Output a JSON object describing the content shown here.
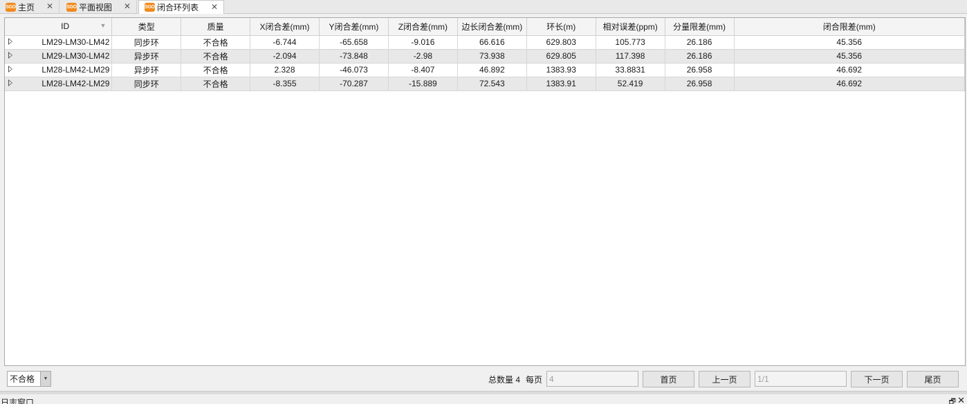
{
  "tabs": [
    {
      "label": "主页",
      "logo": "SGO",
      "close": "✕"
    },
    {
      "label": "平面视图",
      "logo": "SGO",
      "close": "✕"
    },
    {
      "label": "闭合环列表",
      "logo": "SGO",
      "close": "✕"
    }
  ],
  "table": {
    "columns": [
      "ID",
      "类型",
      "质量",
      "X闭合差(mm)",
      "Y闭合差(mm)",
      "Z闭合差(mm)",
      "边长闭合差(mm)",
      "环长(m)",
      "相对误差(ppm)",
      "分量限差(mm)",
      "闭合限差(mm)"
    ],
    "rows": [
      [
        "LM29-LM30-LM42",
        "同步环",
        "不合格",
        "-6.744",
        "-65.658",
        "-9.016",
        "66.616",
        "629.803",
        "105.773",
        "26.186",
        "45.356"
      ],
      [
        "LM29-LM30-LM42",
        "异步环",
        "不合格",
        "-2.094",
        "-73.848",
        "-2.98",
        "73.938",
        "629.805",
        "117.398",
        "26.186",
        "45.356"
      ],
      [
        "LM28-LM42-LM29",
        "异步环",
        "不合格",
        "2.328",
        "-46.073",
        "-8.407",
        "46.892",
        "1383.93",
        "33.8831",
        "26.958",
        "46.692"
      ],
      [
        "LM28-LM42-LM29",
        "同步环",
        "不合格",
        "-8.355",
        "-70.287",
        "-15.889",
        "72.543",
        "1383.91",
        "52.419",
        "26.958",
        "46.692"
      ]
    ]
  },
  "footer": {
    "filter_value": "不合格",
    "total_label": "总数量 4",
    "per_page_label": "每页",
    "per_page_value": "4",
    "first_page": "首页",
    "prev_page": "上一页",
    "page_indicator": "1/1",
    "next_page": "下一页",
    "last_page": "尾页"
  },
  "log_window": {
    "title": "日志窗口",
    "pin": "🗗",
    "close": "✕"
  },
  "colors": {
    "logo": "#f08a1c",
    "row_alt": "#e8e8e8",
    "header_bg": "#f4f4f4"
  }
}
